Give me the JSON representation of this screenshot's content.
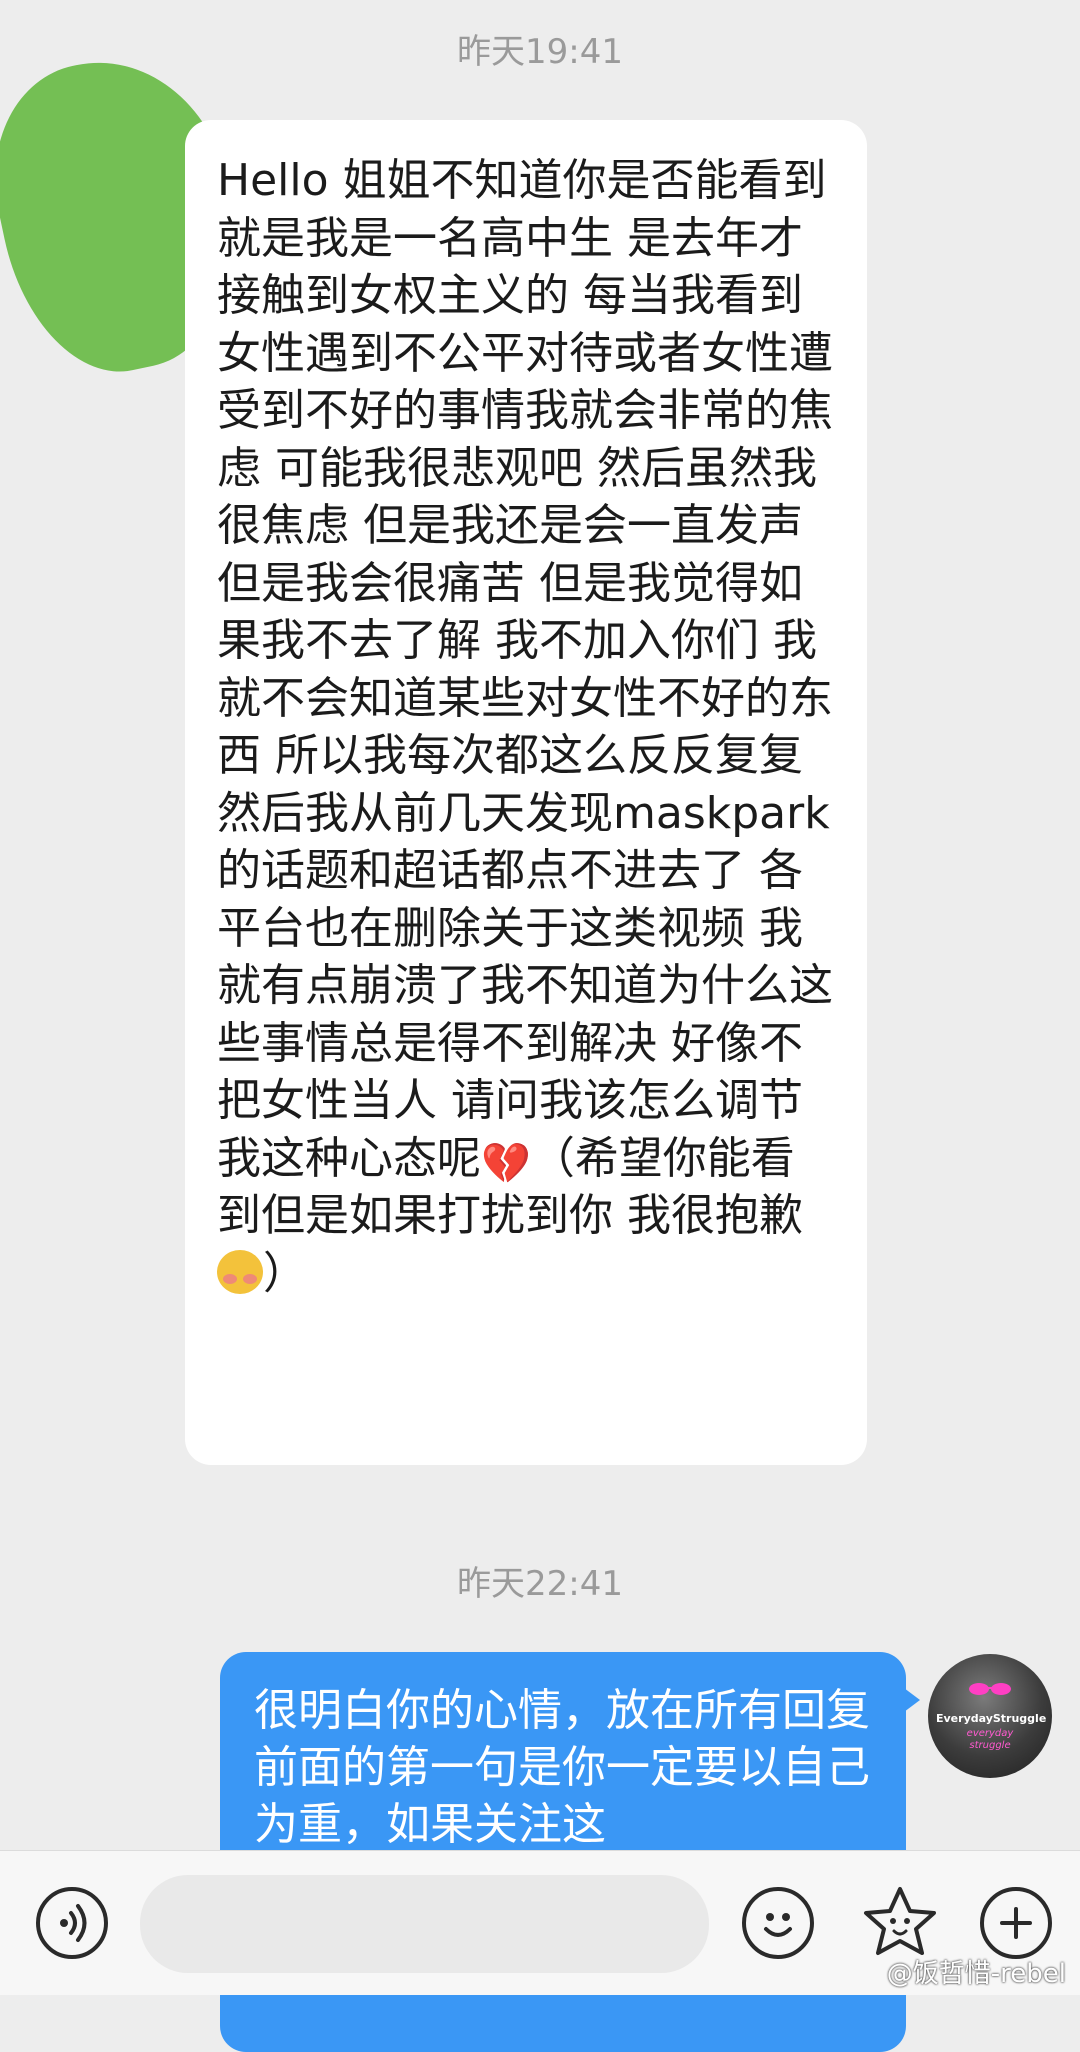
{
  "chat": {
    "messages": [
      {
        "timestamp": "昨天19:41",
        "direction": "incoming",
        "text": "Hello 姐姐不知道你是否能看到 就是我是一名高中生 是去年才接触到女权主义的 每当我看到女性遇到不公平对待或者女性遭受到不好的事情我就会非常的焦虑 可能我很悲观吧 然后虽然我很焦虑 但是我还是会一直发声但是我会很痛苦 但是我觉得如果我不去了解 我不加入你们 我就不会知道某些对女性不好的东西 所以我每次都这么反反复复  然后我从前几天发现maskpark的话题和超话都点不进去了 各平台也在删除关于这类视频 我就有点崩溃了我不知道为什么这些事情总是得不到解决 好像不把女性当人 请问我该怎么调节我这种心态呢",
        "emoji_1": "💔",
        "text_tail": "（希望你能看到但是如果打扰到你 我很抱歉",
        "emoji_2": "blushing-face",
        "closing": "）"
      },
      {
        "timestamp": "昨天22:41",
        "direction": "outgoing",
        "text": "很明白你的心情，放在所有回复前面的第一句是你一定要以自己为重，如果关注这",
        "avatar_label": "EverydayStruggle",
        "avatar_sub": "everyday struggle"
      }
    ]
  },
  "input_bar": {
    "placeholder": "",
    "icons": [
      "voice-icon",
      "emoji-icon",
      "sticker-icon",
      "plus-icon"
    ]
  },
  "watermark": "@饭哲惜-rebel",
  "colors": {
    "background": "#ededed",
    "incoming_bubble": "#ffffff",
    "outgoing_bubble": "#3a97f5",
    "avatar_green": "#74bf54"
  }
}
